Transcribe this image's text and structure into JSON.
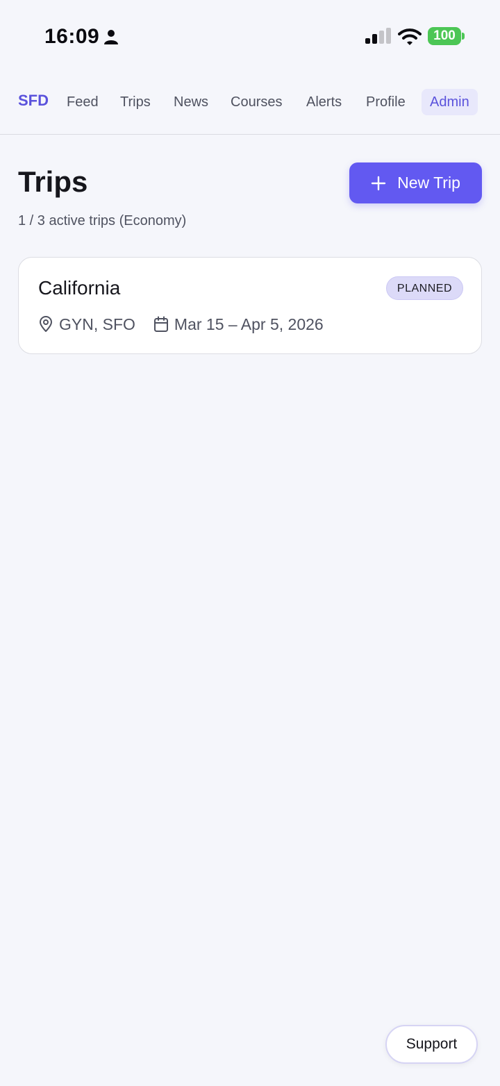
{
  "status_bar": {
    "time": "16:09",
    "battery": "100",
    "icons": [
      "person-icon",
      "signal-icon",
      "wifi-icon",
      "battery-icon"
    ]
  },
  "nav": {
    "brand": "SFD",
    "items": [
      {
        "label": "Feed",
        "active": false
      },
      {
        "label": "Trips",
        "active": false
      },
      {
        "label": "News",
        "active": false
      },
      {
        "label": "Courses",
        "active": false
      },
      {
        "label": "Alerts",
        "active": false
      },
      {
        "label": "Profile",
        "active": false
      },
      {
        "label": "Admin",
        "active": true
      }
    ]
  },
  "header": {
    "title": "Trips",
    "subtitle": "1 / 3 active trips (Economy)",
    "new_trip_label": "New Trip"
  },
  "trips": [
    {
      "name": "California",
      "status": "PLANNED",
      "locations": "GYN, SFO",
      "dates": "Mar 15 – Apr 5, 2026"
    }
  ],
  "support_label": "Support",
  "colors": {
    "accent": "#6259f1",
    "brand": "#5a52dc",
    "background": "#f5f6fb",
    "badge_bg": "#dcdaf8",
    "battery": "#4cc655"
  }
}
